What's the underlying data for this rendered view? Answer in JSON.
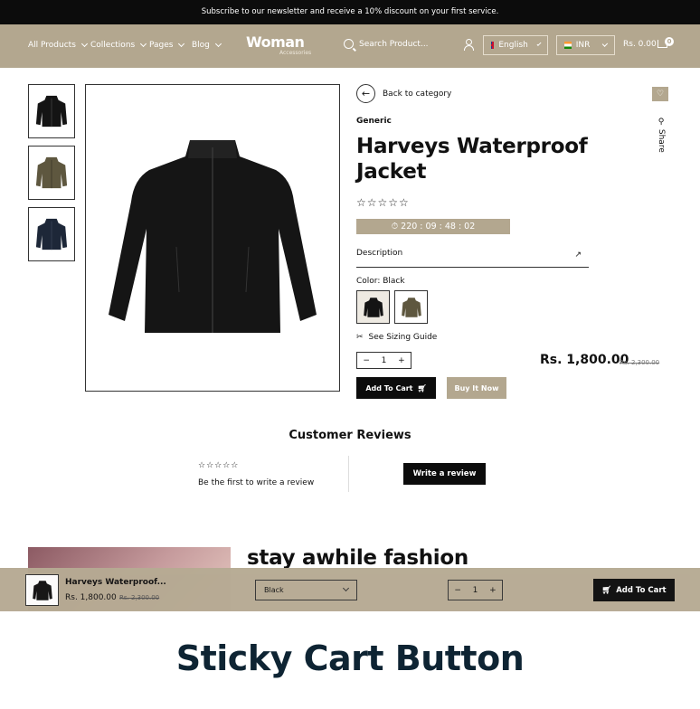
{
  "announcement": "Subscribe to our newsletter and receive a 10% discount on your first service.",
  "nav": {
    "links": [
      "All Products",
      "Collections",
      "Pages",
      "Blog"
    ],
    "logo_main": "Woman",
    "logo_sub": "Accessories",
    "search_placeholder": "Search Product...",
    "language": "English",
    "currency": "INR",
    "cart_total": "Rs. 0.00",
    "cart_count": "0"
  },
  "product": {
    "back_label": "Back to category",
    "share_label": "Share",
    "vendor": "Generic",
    "title": "Harveys Waterproof Jacket",
    "rating_stars": "☆☆☆☆☆",
    "timer": "220 : 09 : 48 : 02",
    "description_label": "Description",
    "color_label": "Color: Black",
    "sizing_label": "See Sizing Guide",
    "quantity": "1",
    "price": "Rs. 1,800.00",
    "compare_price": "Rs. 2,300.00",
    "add_to_cart": "Add To Cart",
    "buy_now": "Buy It Now"
  },
  "reviews": {
    "title": "Customer Reviews",
    "stars": "☆☆☆☆☆",
    "empty_text": "Be the first to write a review",
    "write_button": "Write a review"
  },
  "promo": {
    "title": "stay awhile fashion"
  },
  "sticky": {
    "name": "Harveys Waterproof...",
    "price": "Rs. 1,800.00",
    "compare_price": "Rs. 2,300.00",
    "variant": "Black",
    "quantity": "1",
    "add_to_cart": "Add To Cart"
  },
  "caption": "Sticky Cart Button",
  "colors": {
    "accent": "#b3a78f",
    "dark": "#0c0c0c",
    "caption": "#0e2433"
  }
}
